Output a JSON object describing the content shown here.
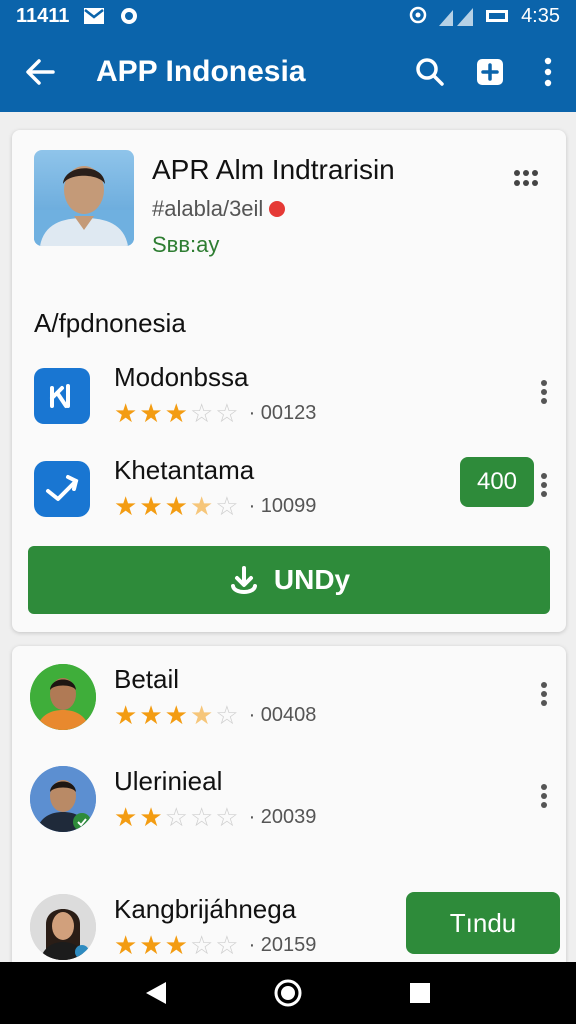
{
  "status_bar": {
    "time": "11411",
    "right_time": "4:35"
  },
  "app_bar": {
    "title": "APP Indonesia"
  },
  "profile": {
    "name": "APR Alm Indtrarisin",
    "handle": "#alabla/3eil",
    "status": "Sвв:ay"
  },
  "section": {
    "title": "A/fpdnonesia"
  },
  "apps": [
    {
      "name": "Modonbssa",
      "rating": 3,
      "count": "00123"
    },
    {
      "name": "Khetantama",
      "rating": 3.5,
      "count": "10099",
      "badge": "400"
    }
  ],
  "download_button": {
    "label": "UNDy"
  },
  "people": [
    {
      "name": "Betail",
      "rating": 3.5,
      "count": "00408"
    },
    {
      "name": "Ulerinieal",
      "rating": 2,
      "count": "20039"
    },
    {
      "name": "Kangbrijáhnega",
      "rating": 3,
      "count": "20159",
      "button": "Tındu"
    }
  ],
  "colors": {
    "primary": "#0b64ab",
    "accent": "#2e8b3a",
    "star": "#f39c12"
  }
}
